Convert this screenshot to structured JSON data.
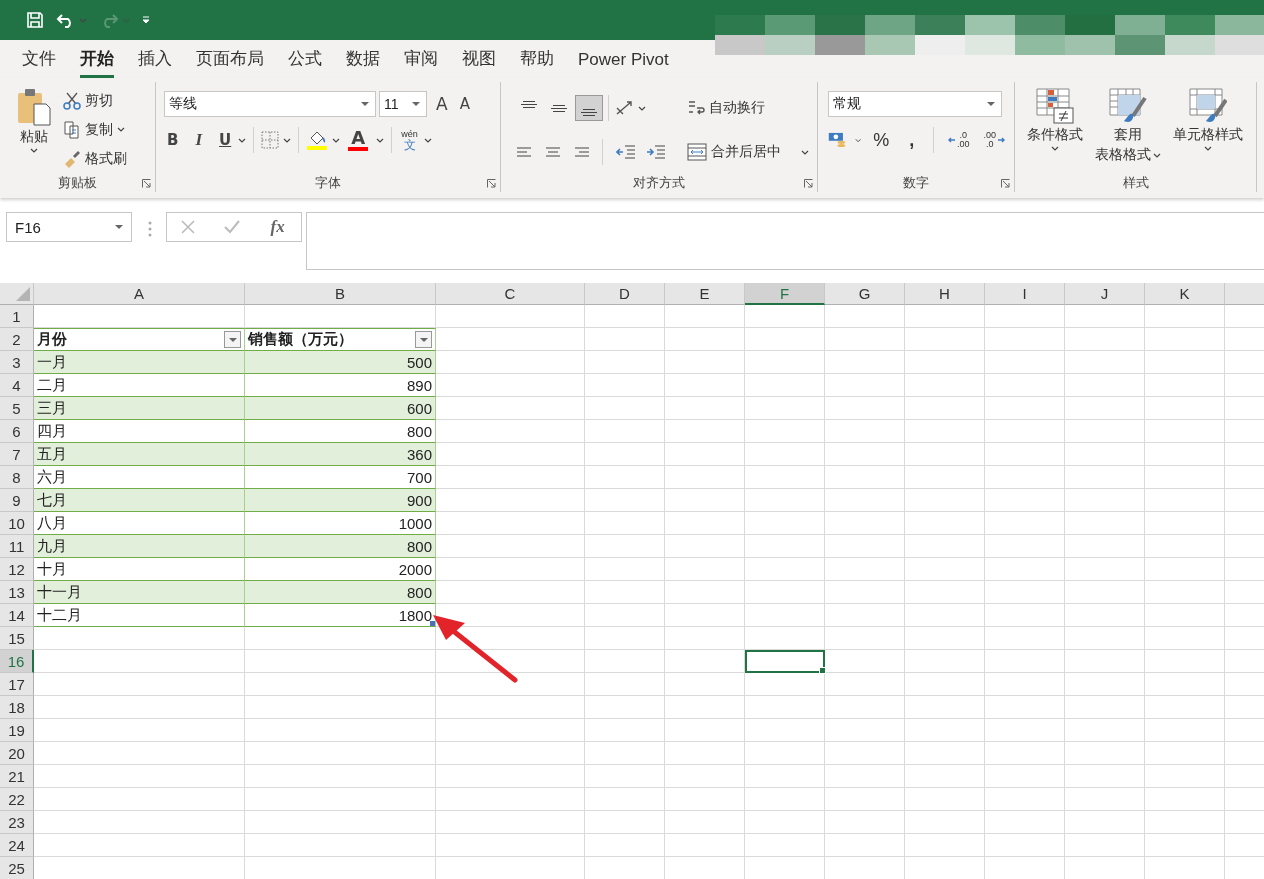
{
  "quick_access": [
    {
      "kind": "save",
      "disabled": false
    },
    {
      "kind": "undo",
      "disabled": false
    },
    {
      "kind": "redo",
      "disabled": true
    },
    {
      "kind": "customize",
      "disabled": false
    }
  ],
  "ribbon_tabs": [
    {
      "label": "文件",
      "selected": false
    },
    {
      "label": "开始",
      "selected": true
    },
    {
      "label": "插入",
      "selected": false
    },
    {
      "label": "页面布局",
      "selected": false
    },
    {
      "label": "公式",
      "selected": false
    },
    {
      "label": "数据",
      "selected": false
    },
    {
      "label": "审阅",
      "selected": false
    },
    {
      "label": "视图",
      "selected": false
    },
    {
      "label": "帮助",
      "selected": false
    },
    {
      "label": "Power Pivot",
      "selected": false
    }
  ],
  "clipboard": {
    "title": "剪贴板",
    "paste": "粘贴",
    "cut": "剪切",
    "copy": "复制",
    "format_painter": "格式刷"
  },
  "font": {
    "title": "字体",
    "font_name": "等线",
    "font_size": "11",
    "grow_glyph": "A",
    "shrink_glyph": "A",
    "bold_glyph": "B",
    "italic_glyph": "I",
    "underline_glyph": "U",
    "font_color_glyph": "A",
    "phonetic_top": "wén",
    "phonetic_bottom": "文"
  },
  "alignment": {
    "title": "对齐方式",
    "vertical": [
      {
        "kind": "top",
        "selected": false
      },
      {
        "kind": "middle",
        "selected": false
      },
      {
        "kind": "bottom",
        "selected": true
      }
    ],
    "wrap_text": "自动换行",
    "merge_center": "合并后居中"
  },
  "number": {
    "title": "数字",
    "format": "常规",
    "percent": "%",
    "comma": ",",
    "decimals": [
      {
        "kind": "increase",
        "top": ".0",
        "bottom": ".00"
      },
      {
        "kind": "decrease",
        "top": ".00",
        "bottom": ".0"
      }
    ]
  },
  "styles": {
    "title": "样式",
    "conditional": "条件格式",
    "table_format_top": "套用",
    "table_format_bottom": "表格格式",
    "cell_styles": "单元格样式"
  },
  "formula_bar": {
    "name_box": "F16",
    "function_label": "fx"
  },
  "sheet": {
    "columns": [
      {
        "label": "A",
        "selected": false
      },
      {
        "label": "B",
        "selected": false
      },
      {
        "label": "C",
        "selected": false
      },
      {
        "label": "D",
        "selected": false
      },
      {
        "label": "E",
        "selected": false
      },
      {
        "label": "F",
        "selected": true
      },
      {
        "label": "G",
        "selected": false
      },
      {
        "label": "H",
        "selected": false
      },
      {
        "label": "I",
        "selected": false
      },
      {
        "label": "J",
        "selected": false
      },
      {
        "label": "K",
        "selected": false
      }
    ],
    "rows": [
      {
        "label": "1",
        "kind": "empty",
        "selected": false
      },
      {
        "label": "2",
        "kind": "table_header",
        "selected": false,
        "cells": [
          "月份",
          "销售额（万元）"
        ]
      },
      {
        "label": "3",
        "kind": "table_row",
        "selected": false,
        "band": true,
        "cells": [
          "一月",
          "500"
        ]
      },
      {
        "label": "4",
        "kind": "table_row",
        "selected": false,
        "band": false,
        "cells": [
          "二月",
          "890"
        ]
      },
      {
        "label": "5",
        "kind": "table_row",
        "selected": false,
        "band": true,
        "cells": [
          "三月",
          "600"
        ]
      },
      {
        "label": "6",
        "kind": "table_row",
        "selected": false,
        "band": false,
        "cells": [
          "四月",
          "800"
        ]
      },
      {
        "label": "7",
        "kind": "table_row",
        "selected": false,
        "band": true,
        "cells": [
          "五月",
          "360"
        ]
      },
      {
        "label": "8",
        "kind": "table_row",
        "selected": false,
        "band": false,
        "cells": [
          "六月",
          "700"
        ]
      },
      {
        "label": "9",
        "kind": "table_row",
        "selected": false,
        "band": true,
        "cells": [
          "七月",
          "900"
        ]
      },
      {
        "label": "10",
        "kind": "table_row",
        "selected": false,
        "band": false,
        "cells": [
          "八月",
          "1000"
        ]
      },
      {
        "label": "11",
        "kind": "table_row",
        "selected": false,
        "band": true,
        "cells": [
          "九月",
          "800"
        ]
      },
      {
        "label": "12",
        "kind": "table_row",
        "selected": false,
        "band": false,
        "cells": [
          "十月",
          "2000"
        ]
      },
      {
        "label": "13",
        "kind": "table_row",
        "selected": false,
        "band": true,
        "cells": [
          "十一月",
          "800"
        ]
      },
      {
        "label": "14",
        "kind": "table_row",
        "selected": false,
        "band": false,
        "cells": [
          "十二月",
          "1800"
        ]
      },
      {
        "label": "15",
        "kind": "empty",
        "selected": false
      },
      {
        "label": "16",
        "kind": "empty",
        "selected": true
      },
      {
        "label": "17",
        "kind": "empty",
        "selected": false
      },
      {
        "label": "18",
        "kind": "empty",
        "selected": false
      },
      {
        "label": "19",
        "kind": "empty",
        "selected": false
      },
      {
        "label": "20",
        "kind": "empty",
        "selected": false
      },
      {
        "label": "21",
        "kind": "empty",
        "selected": false
      },
      {
        "label": "22",
        "kind": "empty",
        "selected": false
      },
      {
        "label": "23",
        "kind": "empty",
        "selected": false
      },
      {
        "label": "24",
        "kind": "empty",
        "selected": false
      },
      {
        "label": "25",
        "kind": "empty",
        "selected": false
      }
    ]
  }
}
